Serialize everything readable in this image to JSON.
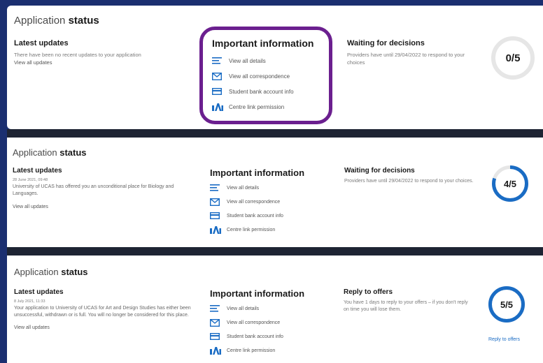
{
  "panels": [
    {
      "title_light": "Application",
      "title_bold": "status",
      "updates": {
        "heading": "Latest updates",
        "date": "",
        "text": "There have been no recent updates to your application",
        "link": "View all updates"
      },
      "info": {
        "heading": "Important information",
        "items": [
          "View all details",
          "View all correspondence",
          "Student bank account info",
          "Centre link permission"
        ]
      },
      "decision": {
        "heading": "Waiting for decisions",
        "text": "Providers have until 29/04/2022 to respond to your choices",
        "link": ""
      },
      "progress": {
        "label": "0/5",
        "done": 0,
        "total": 5
      }
    },
    {
      "title_light": "Application",
      "title_bold": "status",
      "updates": {
        "heading": "Latest updates",
        "date": "28 June 2021, 09:48",
        "text": "University of UCAS has offered you an unconditional place for Biology and Languages.",
        "link": "View all updates"
      },
      "info": {
        "heading": "Important information",
        "items": [
          "View all details",
          "View all correspondence",
          "Student bank account info",
          "Centre link permission"
        ]
      },
      "decision": {
        "heading": "Waiting for decisions",
        "text": "Providers have until 29/04/2022 to respond to your choices.",
        "link": ""
      },
      "progress": {
        "label": "4/5",
        "done": 4,
        "total": 5
      }
    },
    {
      "title_light": "Application",
      "title_bold": "status",
      "updates": {
        "heading": "Latest updates",
        "date": "8 July 2021, 11:33",
        "text": "Your application to University of UCAS for Art and Design Studies has either been unsuccessful, withdrawn or is full. You will no longer be considered for this place.",
        "link": "View all updates"
      },
      "info": {
        "heading": "Important information",
        "items": [
          "View all details",
          "View all correspondence",
          "Student bank account info",
          "Centre link permission"
        ]
      },
      "decision": {
        "heading": "Reply to offers",
        "text": "You have 1 days to reply to your offers – if you don't reply on time you will lose them.",
        "link": "Reply to offers"
      },
      "progress": {
        "label": "5/5",
        "done": 5,
        "total": 5
      }
    }
  ],
  "icons": [
    "details-list-icon",
    "envelope-icon",
    "bank-card-icon",
    "centre-link-icon"
  ],
  "colors": {
    "background": "#1b2f70",
    "accent": "#1a6cc4",
    "highlight": "#6b1f8f",
    "ring_track": "#e6e6e6"
  }
}
